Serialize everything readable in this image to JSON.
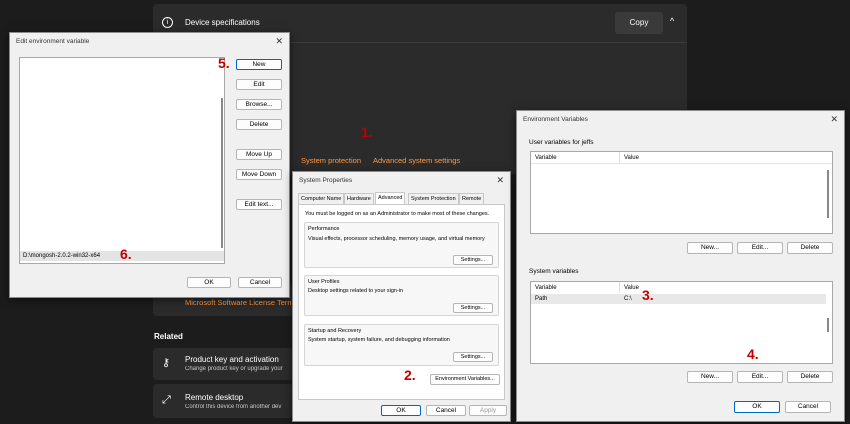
{
  "settings": {
    "device_specs_title": "Device specifications",
    "copy_label": "Copy",
    "system_protection": "System protection",
    "advanced_settings": "Advanced system settings",
    "license_terms": "Microsoft Software License Terms",
    "related": "Related",
    "product_key_title": "Product key and activation",
    "product_key_sub": "Change product key or upgrade your",
    "remote_desktop_title": "Remote desktop",
    "remote_desktop_sub": "Control this device from another dev"
  },
  "edit_env": {
    "title": "Edit environment variable",
    "path_entry": "D:\\mongosh-2.0.2-win32-x64",
    "buttons": {
      "new": "New",
      "edit": "Edit",
      "browse": "Browse...",
      "delete": "Delete",
      "move_up": "Move Up",
      "move_down": "Move Down",
      "edit_text": "Edit text...",
      "ok": "OK",
      "cancel": "Cancel"
    }
  },
  "sys_props": {
    "title": "System Properties",
    "tabs": [
      "Computer Name",
      "Hardware",
      "Advanced",
      "System Protection",
      "Remote"
    ],
    "admin_note": "You must be logged on as an Administrator to make most of these changes.",
    "performance_title": "Performance",
    "performance_desc": "Visual effects, processor scheduling, memory usage, and virtual memory",
    "user_profiles_title": "User Profiles",
    "user_profiles_desc": "Desktop settings related to your sign-in",
    "startup_title": "Startup and Recovery",
    "startup_desc": "System startup, system failure, and debugging information",
    "settings_label": "Settings...",
    "env_vars_label": "Environment Variables...",
    "ok": "OK",
    "cancel": "Cancel",
    "apply": "Apply"
  },
  "env_vars": {
    "title": "Environment Variables",
    "user_vars_label": "User variables for jeffs",
    "system_vars_label": "System variables",
    "col_variable": "Variable",
    "col_value": "Value",
    "system_rows": [
      {
        "variable": "Path",
        "value": "C:\\"
      }
    ],
    "new": "New...",
    "edit": "Edit...",
    "delete": "Delete",
    "ok": "OK",
    "cancel": "Cancel"
  },
  "steps": [
    "1.",
    "2.",
    "3.",
    "4.",
    "5.",
    "6."
  ],
  "colors": {
    "step_red": "#c00000",
    "link_orange": "#ff9a4a",
    "dark_bg": "#1c1c1c"
  }
}
